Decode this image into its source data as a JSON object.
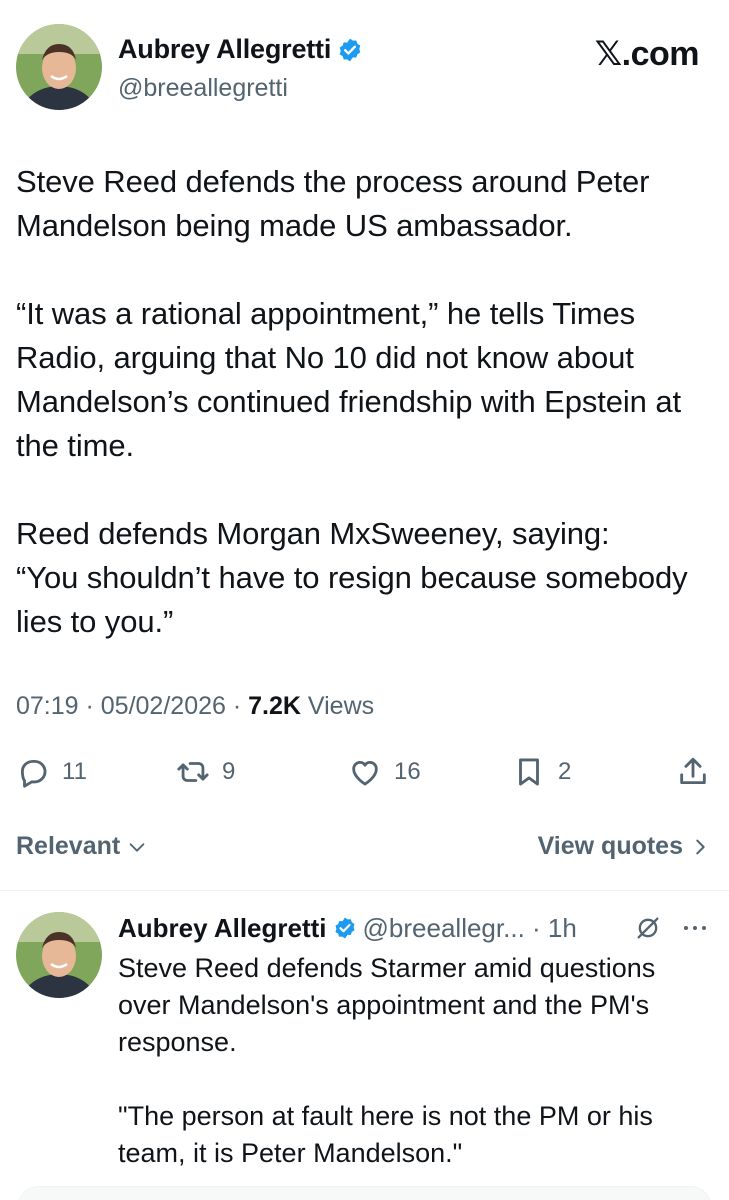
{
  "brand": {
    "site": "𝕏.com"
  },
  "tweet": {
    "author_name": "Aubrey Allegretti",
    "author_handle": "@breeallegretti",
    "paragraphs": [
      "Steve Reed defends the process around Peter Mandelson being made US ambassador.",
      "“It was a rational appointment,” he tells Times Radio, arguing that No 10 did not know about Mandelson’s continued friendship with Epstein at the time.",
      "Reed defends Morgan MxSweeney, saying:\n“You shouldn’t have to resign because somebody lies to you.”"
    ],
    "time": "07:19 · 05/02/2026 · ",
    "views_count": "7.2K",
    "views_label": " Views",
    "stats": {
      "replies": "11",
      "reposts": "9",
      "likes": "16",
      "bookmarks": "2"
    }
  },
  "filters": {
    "sort_label": "Relevant",
    "quotes_label": "View quotes"
  },
  "reply": {
    "author_name": "Aubrey Allegretti",
    "author_handle": "@breeallegr... · 1h",
    "paragraphs": [
      "Steve Reed defends Starmer amid questions over Mandelson's appointment and the PM's response.",
      "\"The person at fault here is not the PM or his team, it is Peter Mandelson.\""
    ]
  },
  "colors": {
    "text": "#0f1419",
    "secondary": "#536471",
    "verified": "#1d9bf0",
    "divider": "#eff3f4"
  },
  "icons": [
    "verified-badge-icon",
    "reply-icon",
    "repost-icon",
    "like-icon",
    "bookmark-icon",
    "share-icon",
    "chevron-down-icon",
    "chevron-right-icon",
    "grok-icon",
    "more-icon"
  ]
}
